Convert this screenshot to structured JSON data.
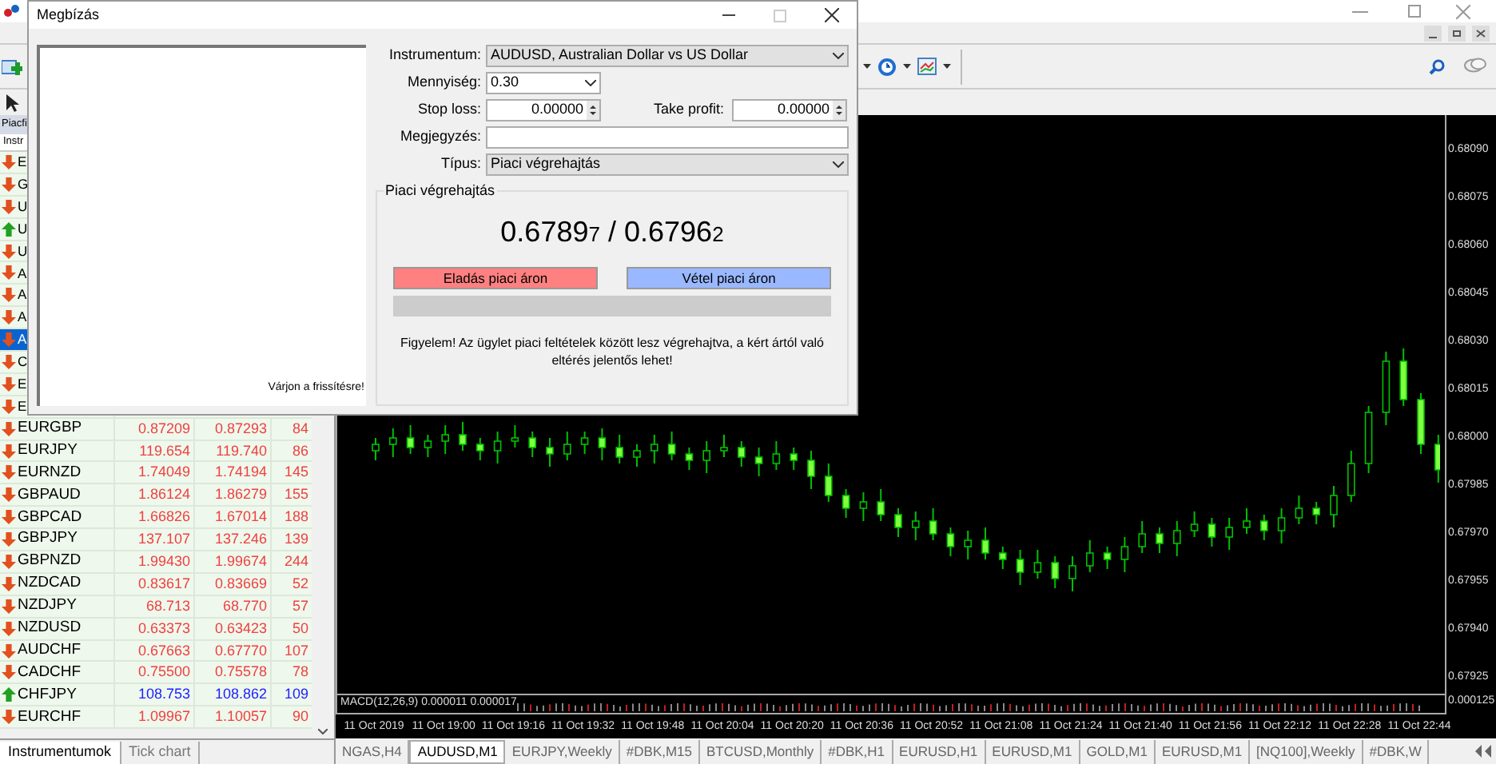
{
  "main_window": {
    "menu_fragment": "Piacfi",
    "column_fragment": "Instr"
  },
  "market_watch": [
    {
      "symbol": "E",
      "kind": "down",
      "selected": false
    },
    {
      "symbol": "G",
      "kind": "down",
      "selected": false
    },
    {
      "symbol": "U",
      "kind": "down",
      "selected": false
    },
    {
      "symbol": "U",
      "kind": "up",
      "selected": false
    },
    {
      "symbol": "U",
      "kind": "down",
      "selected": false
    },
    {
      "symbol": "A",
      "kind": "down",
      "selected": false
    },
    {
      "symbol": "A",
      "kind": "down",
      "selected": false
    },
    {
      "symbol": "A",
      "kind": "down",
      "selected": false
    },
    {
      "symbol": "A",
      "kind": "down",
      "selected": true
    },
    {
      "symbol": "C",
      "kind": "down",
      "selected": false
    },
    {
      "symbol": "E",
      "kind": "down",
      "selected": false
    },
    {
      "symbol": "E",
      "kind": "down",
      "selected": false
    },
    {
      "symbol": "EURGBP",
      "bid": "0.87209",
      "ask": "0.87293",
      "spread": "84",
      "kind": "down",
      "selected": false
    },
    {
      "symbol": "EURJPY",
      "bid": "119.654",
      "ask": "119.740",
      "spread": "86",
      "kind": "down",
      "selected": false
    },
    {
      "symbol": "EURNZD",
      "bid": "1.74049",
      "ask": "1.74194",
      "spread": "145",
      "kind": "down",
      "selected": false
    },
    {
      "symbol": "GBPAUD",
      "bid": "1.86124",
      "ask": "1.86279",
      "spread": "155",
      "kind": "down",
      "selected": false
    },
    {
      "symbol": "GBPCAD",
      "bid": "1.66826",
      "ask": "1.67014",
      "spread": "188",
      "kind": "down",
      "selected": false
    },
    {
      "symbol": "GBPJPY",
      "bid": "137.107",
      "ask": "137.246",
      "spread": "139",
      "kind": "down",
      "selected": false
    },
    {
      "symbol": "GBPNZD",
      "bid": "1.99430",
      "ask": "1.99674",
      "spread": "244",
      "kind": "down",
      "selected": false
    },
    {
      "symbol": "NZDCAD",
      "bid": "0.83617",
      "ask": "0.83669",
      "spread": "52",
      "kind": "down",
      "selected": false
    },
    {
      "symbol": "NZDJPY",
      "bid": "68.713",
      "ask": "68.770",
      "spread": "57",
      "kind": "down",
      "selected": false
    },
    {
      "symbol": "NZDUSD",
      "bid": "0.63373",
      "ask": "0.63423",
      "spread": "50",
      "kind": "down",
      "selected": false
    },
    {
      "symbol": "AUDCHF",
      "bid": "0.67663",
      "ask": "0.67770",
      "spread": "107",
      "kind": "down",
      "selected": false
    },
    {
      "symbol": "CADCHF",
      "bid": "0.75500",
      "ask": "0.75578",
      "spread": "78",
      "kind": "down",
      "selected": false
    },
    {
      "symbol": "CHFJPY",
      "bid": "108.753",
      "ask": "108.862",
      "spread": "109",
      "kind": "up",
      "selected": false
    },
    {
      "symbol": "EURCHF",
      "bid": "1.09967",
      "ask": "1.10057",
      "spread": "90",
      "kind": "down",
      "selected": false
    }
  ],
  "market_watch_tabs": [
    {
      "label": "Instrumentumok",
      "selected": true
    },
    {
      "label": "Tick chart",
      "selected": false
    }
  ],
  "chart": {
    "chart_data": {
      "type": "candlestick",
      "ylim": [
        0.6792,
        0.68101
      ],
      "categories": [
        "11 Oct 2019",
        null,
        null,
        null,
        "11 Oct 19:00",
        null,
        null,
        null,
        "11 Oct 19:16",
        null,
        null,
        null,
        "11 Oct 19:32",
        null,
        null,
        null,
        "11 Oct 19:48",
        null,
        null,
        null,
        "11 Oct 20:04",
        null,
        null,
        null,
        "11 Oct 20:20",
        null,
        null,
        null,
        "11 Oct 20:36",
        null,
        null,
        null,
        "11 Oct 20:52",
        null,
        null,
        null,
        "11 Oct 21:08",
        null,
        null,
        null,
        "11 Oct 21:24",
        null,
        null,
        null,
        "11 Oct 21:40",
        null,
        null,
        null,
        "11 Oct 21:56",
        null,
        null,
        null,
        "11 Oct 22:12",
        null,
        null,
        null,
        "11 Oct 22:28",
        null,
        null,
        null,
        "11 Oct 22:44",
        null
      ],
      "ohlc": [
        [
          0.67996,
          0.68,
          0.67993,
          0.67998
        ],
        [
          0.67998,
          0.68003,
          0.67994,
          0.68
        ],
        [
          0.68,
          0.68004,
          0.67995,
          0.67997
        ],
        [
          0.67997,
          0.68001,
          0.67994,
          0.67999
        ],
        [
          0.67999,
          0.68004,
          0.67995,
          0.68001
        ],
        [
          0.68001,
          0.68005,
          0.67996,
          0.67998
        ],
        [
          0.67998,
          0.68,
          0.67993,
          0.67996
        ],
        [
          0.67996,
          0.68002,
          0.67992,
          0.67999
        ],
        [
          0.67999,
          0.68004,
          0.67997,
          0.68
        ],
        [
          0.68,
          0.68002,
          0.67994,
          0.67997
        ],
        [
          0.67997,
          0.68,
          0.67991,
          0.67995
        ],
        [
          0.67995,
          0.68002,
          0.67993,
          0.67998
        ],
        [
          0.67998,
          0.68002,
          0.67995,
          0.68
        ],
        [
          0.68,
          0.68003,
          0.67993,
          0.67997
        ],
        [
          0.67997,
          0.68001,
          0.67992,
          0.67994
        ],
        [
          0.67994,
          0.67998,
          0.67991,
          0.67996
        ],
        [
          0.67996,
          0.68001,
          0.67992,
          0.67998
        ],
        [
          0.67998,
          0.68002,
          0.67993,
          0.67995
        ],
        [
          0.67995,
          0.67997,
          0.6799,
          0.67993
        ],
        [
          0.67993,
          0.67999,
          0.67989,
          0.67996
        ],
        [
          0.67996,
          0.68001,
          0.67994,
          0.67997
        ],
        [
          0.67997,
          0.67999,
          0.67991,
          0.67994
        ],
        [
          0.67994,
          0.67997,
          0.67988,
          0.67992
        ],
        [
          0.67992,
          0.67999,
          0.6799,
          0.67995
        ],
        [
          0.67995,
          0.67997,
          0.6799,
          0.67993
        ],
        [
          0.67993,
          0.67996,
          0.67984,
          0.67988
        ],
        [
          0.67988,
          0.67992,
          0.6798,
          0.67982
        ],
        [
          0.67982,
          0.67984,
          0.67975,
          0.67978
        ],
        [
          0.67978,
          0.67983,
          0.67974,
          0.6798
        ],
        [
          0.6798,
          0.67984,
          0.67974,
          0.67976
        ],
        [
          0.67976,
          0.67978,
          0.67969,
          0.67972
        ],
        [
          0.67972,
          0.67977,
          0.67968,
          0.67974
        ],
        [
          0.67974,
          0.67978,
          0.67968,
          0.6797
        ],
        [
          0.6797,
          0.67972,
          0.67963,
          0.67966
        ],
        [
          0.67966,
          0.67971,
          0.67962,
          0.67968
        ],
        [
          0.67968,
          0.67972,
          0.67962,
          0.67964
        ],
        [
          0.67964,
          0.67966,
          0.67959,
          0.67962
        ],
        [
          0.67962,
          0.67965,
          0.67954,
          0.67958
        ],
        [
          0.67958,
          0.67965,
          0.67956,
          0.67961
        ],
        [
          0.67961,
          0.67963,
          0.67953,
          0.67956
        ],
        [
          0.67956,
          0.67963,
          0.67952,
          0.6796
        ],
        [
          0.6796,
          0.67968,
          0.67958,
          0.67964
        ],
        [
          0.67964,
          0.67966,
          0.67959,
          0.67962
        ],
        [
          0.67962,
          0.67969,
          0.67958,
          0.67966
        ],
        [
          0.67966,
          0.67974,
          0.67964,
          0.6797
        ],
        [
          0.6797,
          0.67972,
          0.67964,
          0.67967
        ],
        [
          0.67967,
          0.67974,
          0.67963,
          0.67971
        ],
        [
          0.67971,
          0.67977,
          0.67969,
          0.67973
        ],
        [
          0.67973,
          0.67975,
          0.67966,
          0.67969
        ],
        [
          0.67969,
          0.67975,
          0.67965,
          0.67972
        ],
        [
          0.67972,
          0.67978,
          0.6797,
          0.67974
        ],
        [
          0.67974,
          0.67976,
          0.67968,
          0.67971
        ],
        [
          0.67971,
          0.67978,
          0.67967,
          0.67975
        ],
        [
          0.67975,
          0.67982,
          0.67973,
          0.67978
        ],
        [
          0.67978,
          0.6798,
          0.67973,
          0.67976
        ],
        [
          0.67976,
          0.67985,
          0.67972,
          0.67982
        ],
        [
          0.67982,
          0.67996,
          0.6798,
          0.67992
        ],
        [
          0.67992,
          0.6801,
          0.67989,
          0.68008
        ],
        [
          0.68008,
          0.68027,
          0.68004,
          0.68024
        ],
        [
          0.68024,
          0.68028,
          0.6801,
          0.68012
        ],
        [
          0.68012,
          0.68014,
          0.67995,
          0.67998
        ],
        [
          0.67998,
          0.68001,
          0.67986,
          0.6799
        ]
      ],
      "yticks": [
        {
          "value": 0.6809,
          "label": "0.68090"
        },
        {
          "value": 0.68075,
          "label": "0.68075"
        },
        {
          "value": 0.6806,
          "label": "0.68060"
        },
        {
          "value": 0.68045,
          "label": "0.68045"
        },
        {
          "value": 0.6803,
          "label": "0.68030"
        },
        {
          "value": 0.68015,
          "label": "0.68015"
        },
        {
          "value": 0.68,
          "label": "0.68000"
        },
        {
          "value": 0.67985,
          "label": "0.67985"
        },
        {
          "value": 0.6797,
          "label": "0.67970"
        },
        {
          "value": 0.67955,
          "label": "0.67955"
        },
        {
          "value": 0.6794,
          "label": "0.67940"
        },
        {
          "value": 0.67925,
          "label": "0.67925"
        }
      ]
    },
    "macd_label": "MACD(12,26,9) 0.000011 0.000017",
    "macd_axis": "0.000125"
  },
  "chart_tabs": [
    {
      "label": "NGAS,H4",
      "selected": false
    },
    {
      "label": "AUDUSD,M1",
      "selected": true
    },
    {
      "label": "EURJPY,Weekly",
      "selected": false
    },
    {
      "label": "#DBK,M15",
      "selected": false
    },
    {
      "label": "BTCUSD,Monthly",
      "selected": false
    },
    {
      "label": "#DBK,H1",
      "selected": false
    },
    {
      "label": "EURUSD,H1",
      "selected": false
    },
    {
      "label": "EURUSD,M1",
      "selected": false
    },
    {
      "label": "GOLD,M1",
      "selected": false
    },
    {
      "label": "EURUSD,M1",
      "selected": false
    },
    {
      "label": "[NQ100],Weekly",
      "selected": false
    },
    {
      "label": "#DBK,W",
      "selected": false
    }
  ],
  "order_dialog": {
    "title": "Megbízás",
    "wait_text": "Várjon a frissítésre!",
    "instrument_label": "Instrumentum:",
    "instrument": "AUDUSD, Australian Dollar vs US Dollar",
    "volume_label": "Mennyiség:",
    "volume": "0.30",
    "stop_loss_label": "Stop loss:",
    "stop_loss": "0.00000",
    "take_profit_label": "Take profit:",
    "take_profit": "0.00000",
    "comment_label": "Megjegyzés:",
    "type_label": "Típus:",
    "type": "Piaci végrehajtás",
    "group_title": "Piaci végrehajtás",
    "bid_main": "0.6789",
    "bid_last": "7",
    "separator": "/",
    "ask_main": "0.6796",
    "ask_last": "2",
    "sell_button": "Eladás piaci áron",
    "buy_button": "Vétel piaci áron",
    "progress": {
      "level": 0
    },
    "warning": "Figyelem! Az ügylet piaci feltételek között lesz végrehajtva, a kért ártól való eltérés jelentős lehet!"
  }
}
